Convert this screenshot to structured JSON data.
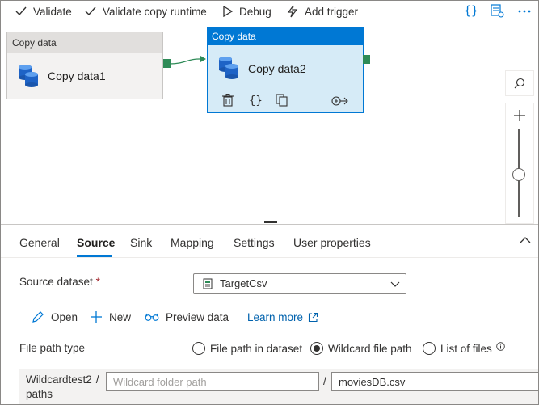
{
  "toolbar": {
    "validate": "Validate",
    "validate_copy_runtime": "Validate copy runtime",
    "debug": "Debug",
    "add_trigger": "Add trigger"
  },
  "canvas": {
    "node1": {
      "header": "Copy data",
      "title": "Copy data1"
    },
    "node2": {
      "header": "Copy data",
      "title": "Copy data2"
    }
  },
  "tabs": [
    "General",
    "Source",
    "Sink",
    "Mapping",
    "Settings",
    "User properties"
  ],
  "active_tab": "Source",
  "source": {
    "dataset_label": "Source dataset",
    "required_mark": "*",
    "dataset_value": "TargetCsv",
    "actions": {
      "open": "Open",
      "new": "New",
      "preview": "Preview data",
      "learn_more": "Learn more"
    },
    "file_path_type_label": "File path type",
    "file_path_options": [
      "File path in dataset",
      "Wildcard file path",
      "List of files"
    ],
    "selected_file_path_option": "Wildcard file path",
    "wildcard_label_line1": "Wildcardtest2",
    "wildcard_label_line2": "paths",
    "slash": "/",
    "folder_placeholder": "Wildcard folder path",
    "file_value": "moviesDB.csv"
  },
  "colors": {
    "accent": "#0078d4",
    "port": "#2e8b57",
    "selected_node_bg": "#d6ebf7"
  }
}
